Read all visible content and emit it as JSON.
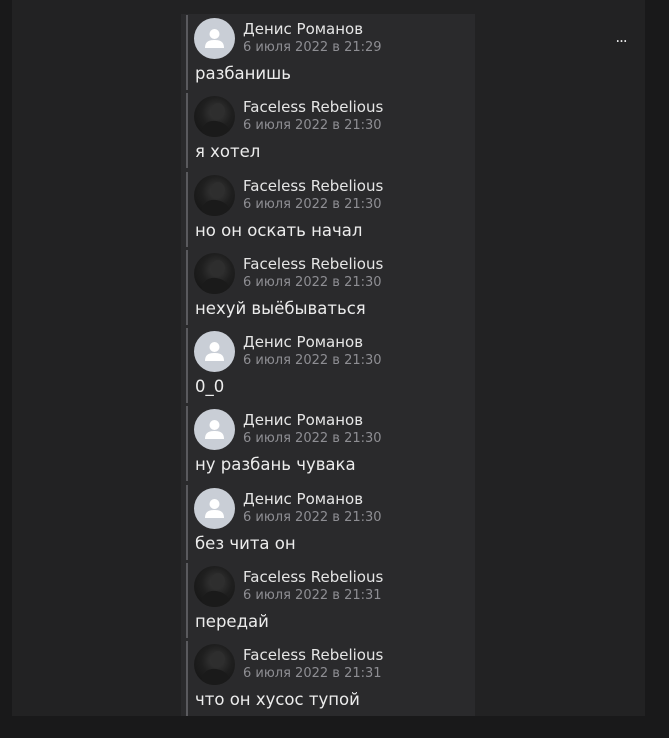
{
  "toolbar": {
    "more_label": "..."
  },
  "messages": [
    {
      "author": "Денис Романов",
      "time": "6 июля 2022 в 21:29",
      "text": "разбанишь",
      "avatar": "default-avatar-icon"
    },
    {
      "author": "Faceless Rebelious",
      "time": "6 июля 2022 в 21:30",
      "text": "я хотел",
      "avatar": "dark-photo-avatar"
    },
    {
      "author": "Faceless Rebelious",
      "time": "6 июля 2022 в 21:30",
      "text": "но он оскать начал",
      "avatar": "dark-photo-avatar"
    },
    {
      "author": "Faceless Rebelious",
      "time": "6 июля 2022 в 21:30",
      "text": "нехуй выёбываться",
      "avatar": "dark-photo-avatar"
    },
    {
      "author": "Денис Романов",
      "time": "6 июля 2022 в 21:30",
      "text": "0_0",
      "avatar": "default-avatar-icon"
    },
    {
      "author": "Денис Романов",
      "time": "6 июля 2022 в 21:30",
      "text": "ну разбань чувака",
      "avatar": "default-avatar-icon"
    },
    {
      "author": "Денис Романов",
      "time": "6 июля 2022 в 21:30",
      "text": "без чита он",
      "avatar": "default-avatar-icon"
    },
    {
      "author": "Faceless Rebelious",
      "time": "6 июля 2022 в 21:31",
      "text": "передай",
      "avatar": "dark-photo-avatar"
    },
    {
      "author": "Faceless Rebelious",
      "time": "6 июля 2022 в 21:31",
      "text": "что он хусос тупой",
      "avatar": "dark-photo-avatar"
    }
  ]
}
